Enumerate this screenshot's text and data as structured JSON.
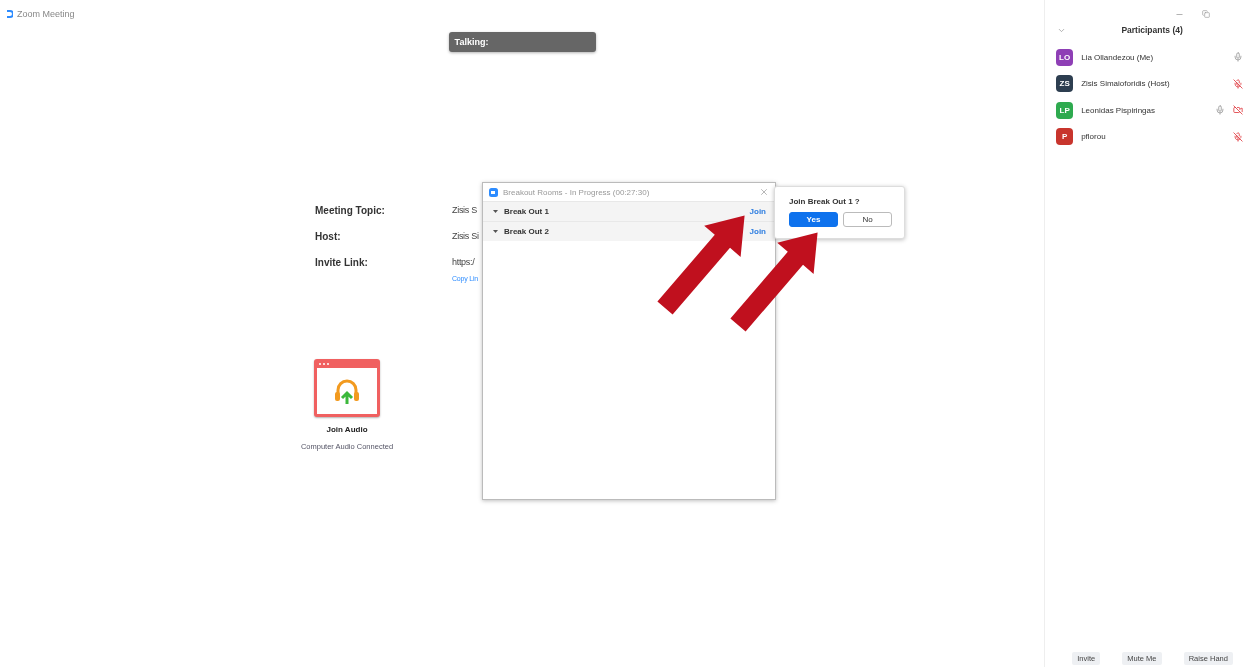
{
  "window": {
    "title": "Zoom Meeting"
  },
  "talking": {
    "label": "Talking:"
  },
  "meeting_info": [
    {
      "label": "Meeting Topic:",
      "value": "Zisis S"
    },
    {
      "label": "Host:",
      "value": "Zisis Si"
    },
    {
      "label": "Invite Link:",
      "value": "https:/"
    }
  ],
  "copy_link": "Copy Lin",
  "audio": {
    "label": "Join Audio",
    "status": "Computer Audio Connected"
  },
  "breakout_dialog": {
    "title": "Breakout Rooms - In Progress (00:27:30)",
    "rooms": [
      {
        "name": "Break Out 1",
        "action": "Join"
      },
      {
        "name": "Break Out 2",
        "action": "Join"
      }
    ]
  },
  "join_prompt": {
    "question": "Join Break Out 1 ?",
    "buttons": [
      {
        "label": "Yes",
        "primary": true
      },
      {
        "label": "No",
        "primary": false
      }
    ]
  },
  "participants_panel": {
    "title": "Participants (4)",
    "participants": [
      {
        "initials": "LO",
        "name": "Lia Ollandezou (Me)",
        "color": "#8e3fb5",
        "mic_muted": false,
        "video_off": false
      },
      {
        "initials": "ZS",
        "name": "Zisis Simaioforidis (Host)",
        "color": "#2d3e50",
        "mic_muted": true,
        "video_off": false
      },
      {
        "initials": "LP",
        "name": "Leonidas Pispiringas",
        "color": "#2eaa4f",
        "mic_muted": false,
        "video_off": true
      },
      {
        "initials": "P",
        "name": "pflorou",
        "color": "#c8352d",
        "mic_muted": true,
        "video_off": false
      }
    ],
    "buttons": [
      "Invite",
      "Mute Me",
      "Raise Hand"
    ]
  }
}
